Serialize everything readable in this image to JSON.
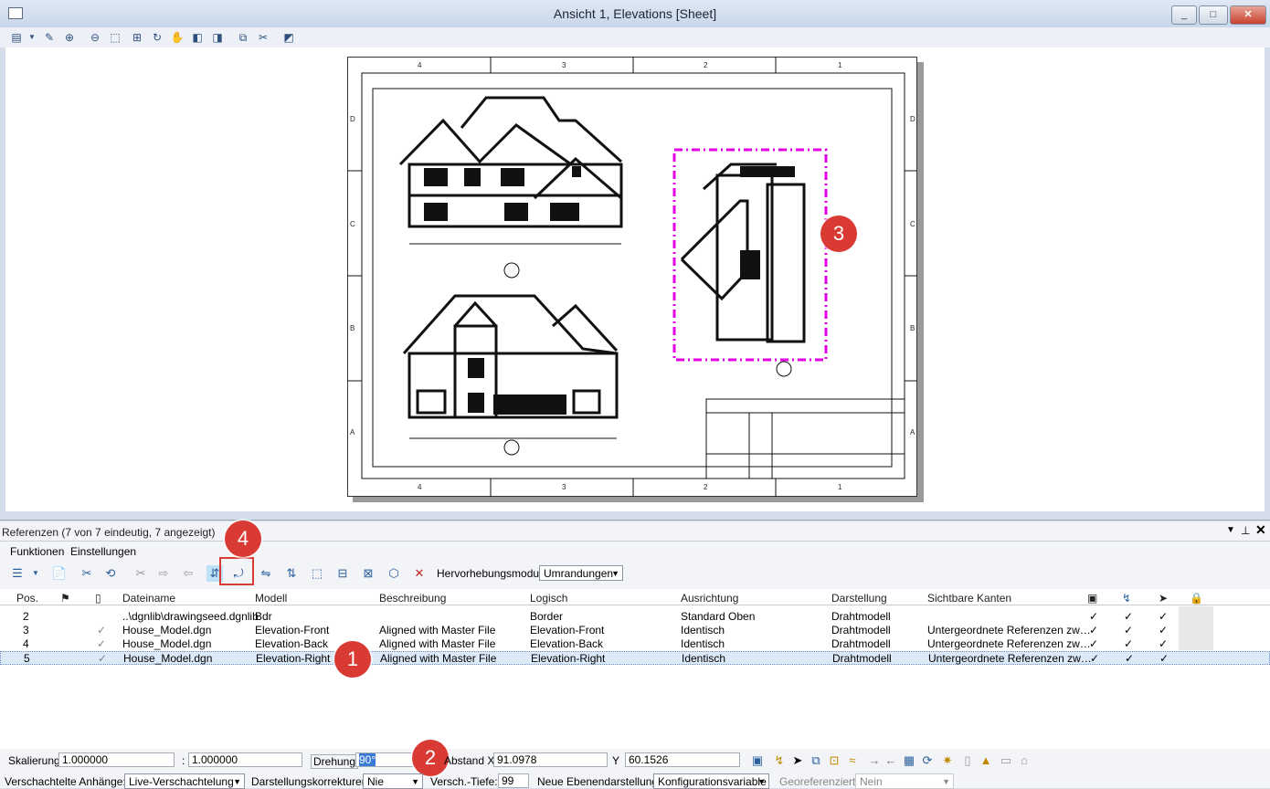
{
  "window": {
    "title": "Ansicht 1, Elevations [Sheet]",
    "minimize": "_",
    "maximize": "□",
    "close": "✕"
  },
  "sheet": {
    "top_cols": [
      "4",
      "3",
      "2",
      "1"
    ],
    "bottom_cols": [
      "4",
      "3",
      "2",
      "1"
    ],
    "rows_left": [
      "D",
      "C",
      "B",
      "A"
    ],
    "rows_right": [
      "D",
      "C",
      "B",
      "A"
    ]
  },
  "panel": {
    "title": "Referenzen (7 von 7 eindeutig, 7 angezeigt)",
    "menu": [
      "Funktionen",
      "Einstellungen"
    ],
    "highlight_label": "Hervorhebungsmodus:",
    "highlight_value": "Umrandungen"
  },
  "table": {
    "headers": [
      "Pos.",
      "Dateiname",
      "Modell",
      "Beschreibung",
      "Logisch",
      "Ausrichtung",
      "Darstellung",
      "Sichtbare Kanten"
    ],
    "rows": [
      {
        "pos": "2",
        "check": "",
        "file": "..\\dgnlib\\drawingseed.dgnlib",
        "model": "Bdr",
        "desc": "",
        "logical": "Border",
        "orient": "Standard Oben",
        "display": "Drahtmodell",
        "edges": ""
      },
      {
        "pos": "3",
        "check": "✓",
        "file": "House_Model.dgn",
        "model": "Elevation-Front",
        "desc": "Aligned with Master File",
        "logical": "Elevation-Front",
        "orient": "Identisch",
        "display": "Drahtmodell",
        "edges": "Untergeordnete Referenzen zw…"
      },
      {
        "pos": "4",
        "check": "✓",
        "file": "House_Model.dgn",
        "model": "Elevation-Back",
        "desc": "Aligned with Master File",
        "logical": "Elevation-Back",
        "orient": "Identisch",
        "display": "Drahtmodell",
        "edges": "Untergeordnete Referenzen zw…"
      },
      {
        "pos": "5",
        "check": "✓",
        "file": "House_Model.dgn",
        "model": "Elevation-Right",
        "desc": "Aligned with Master File",
        "logical": "Elevation-Right",
        "orient": "Identisch",
        "display": "Drahtmodell",
        "edges": "Untergeordnete Referenzen zw…"
      }
    ],
    "tick": "✓"
  },
  "fields": {
    "scale_label": "Skalierung",
    "scale_a": "1.000000",
    "colon": ":",
    "scale_b": "1.000000",
    "rotation_label": "Drehung",
    "rotation_value": "90°",
    "offset_label": "Abstand X",
    "offset_x": "91.0978",
    "y_label": "Y",
    "offset_y": "60.1526",
    "nested_label": "Verschachtelte Anhänge:",
    "nested_value": "Live-Verschachtelung",
    "corrections_label": "Darstellungskorrekturen:",
    "corrections_value": "Nie",
    "depth_label": "Versch.-Tiefe:",
    "depth_value": "99",
    "newlevel_label": "Neue Ebenendarstellung:",
    "newlevel_value": "Konfigurationsvariable",
    "georef_label": "Georeferenziert:",
    "georef_value": "Nein"
  },
  "badges": {
    "b1": "1",
    "b2": "2",
    "b3": "3",
    "b4": "4"
  },
  "colors": {
    "highlight": "#e400e4",
    "badge": "#d93a33",
    "row_selected": "#dbe9f9"
  }
}
